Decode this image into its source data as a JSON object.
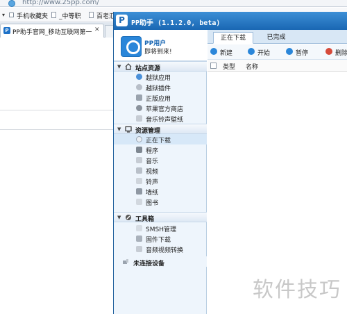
{
  "browser": {
    "address": "http://www.25pp.com/",
    "bookmarks": [
      "手机收藏夹",
      "_中等职",
      "百老汇"
    ],
    "tab_title": "PP助手官网_移动互联网第一门",
    "tab_close": "✕"
  },
  "pp": {
    "logo": "P",
    "title": "PP助手 (1.1.2.0, beta)",
    "user": {
      "name": "PP用户",
      "subtitle": "即将到来!"
    },
    "sections": [
      {
        "label": "站点资源",
        "items": [
          "越狱应用",
          "越狱插件",
          "正版应用",
          "苹果官方商店",
          "音乐铃声壁纸"
        ]
      },
      {
        "label": "资源管理",
        "items": [
          "正在下载",
          "程序",
          "音乐",
          "视频",
          "铃声",
          "墙纸",
          "图书"
        ]
      },
      {
        "label": "工具箱",
        "items": [
          "SMSH管理",
          "固件下载",
          "音频视频转换"
        ]
      },
      {
        "label": "未连接设备",
        "items": []
      }
    ],
    "tabs": [
      "正在下载",
      "已完成"
    ],
    "toolbar": [
      "新建",
      "开始",
      "暂停",
      "删除"
    ],
    "columns": [
      "类型",
      "名称"
    ]
  },
  "watermark": "软件技巧",
  "colors": {
    "title_bar": "#1a67b3",
    "sidebar_bg": "#eef5fc",
    "accent": "#2a86d9"
  }
}
